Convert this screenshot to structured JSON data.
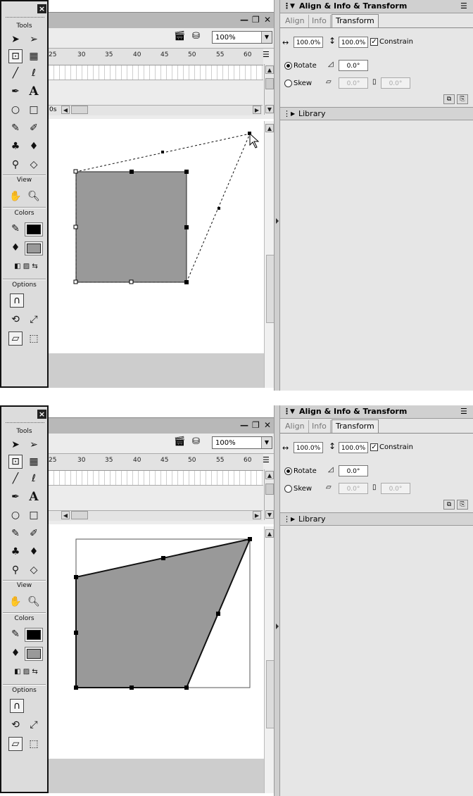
{
  "tools_panel": {
    "close_glyph": "×",
    "tools_label": "Tools",
    "view_label": "View",
    "colors_label": "Colors",
    "options_label": "Options",
    "text_tool_glyph": "A",
    "icons": [
      "arrow-icon",
      "subselect-icon",
      "free-transform-icon",
      "fill-transform-icon",
      "line-icon",
      "lasso-icon",
      "pen-icon",
      "text-icon",
      "oval-icon",
      "rectangle-icon",
      "pencil-icon",
      "brush-icon",
      "ink-bottle-icon",
      "paint-bucket-icon",
      "eyedropper-icon",
      "eraser-icon",
      "hand-icon",
      "zoom-icon",
      "magnet-icon",
      "rotate-skew-icon",
      "scale-icon",
      "distort-icon",
      "envelope-icon"
    ],
    "stroke_color": "#000000",
    "fill_color": "#999999"
  },
  "document": {
    "zoom_value": "100%",
    "ruler_ticks": [
      "25",
      "30",
      "35",
      "40",
      "45",
      "50",
      "55",
      "60"
    ],
    "fps_text": "0s",
    "window_buttons": {
      "minimize": "—",
      "restore": "❐",
      "close": "✕"
    },
    "shape_fill": "#999999"
  },
  "align_panel": {
    "title": "Align & Info & Transform",
    "tabs": [
      "Align",
      "Info",
      "Transform"
    ],
    "active_tab": "Transform",
    "width_value": "100.0%",
    "height_value": "100.0%",
    "constrain_label": "Constrain",
    "constrain_checked": true,
    "rotate_label": "Rotate",
    "rotate_value": "0.0°",
    "skew_label": "Skew",
    "skew_h_value": "0.0°",
    "skew_v_value": "0.0°",
    "library_label": "Library"
  }
}
